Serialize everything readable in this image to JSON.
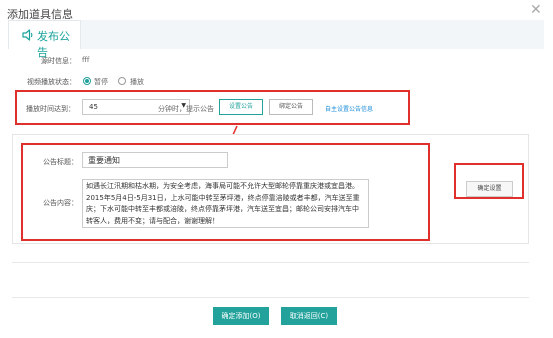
{
  "dialog": {
    "title": "添加道具信息",
    "close_glyph": "✕"
  },
  "tab": {
    "label": "发布公告",
    "icon": "speaker-icon"
  },
  "form": {
    "source_label": "源时信息：",
    "source_value": "fff",
    "status_label": "视频播放状态：",
    "status_options": [
      "暂停",
      "播放"
    ],
    "status_selected": "暂停",
    "time_label": "播放时间达到：",
    "time_value": "45",
    "time_suffix": "分钟时，提示公告",
    "set_button": "设置公告",
    "confirm_button": "绑定公告",
    "custom_link": "自主设置公告信息"
  },
  "notice": {
    "title_label": "公告标题：",
    "title_value": "重要通知",
    "content_label": "公告内容：",
    "content_value": "如遇长江汛期和枯水期，为安全考虑，海事局可能不允许大型邮轮停靠重庆港或宜昌港。2015年5月4日-5月31日，上水可能中转至茅坪港，终点停靠涪陵或者丰都，汽车送至重庆；下水可能中转至丰都或涪陵，终点停靠茅坪港，汽车送至宜昌；邮轮公司安排汽车中转客人，费用不变；请与配合，谢谢理解！",
    "confirm_settings": "确定设置"
  },
  "footer": {
    "ok": "确定添加(O)",
    "cancel": "取消返回(C)"
  },
  "colors": {
    "accent": "#22a29b",
    "annotation": "#e0302c",
    "link": "#1d8ed8"
  }
}
